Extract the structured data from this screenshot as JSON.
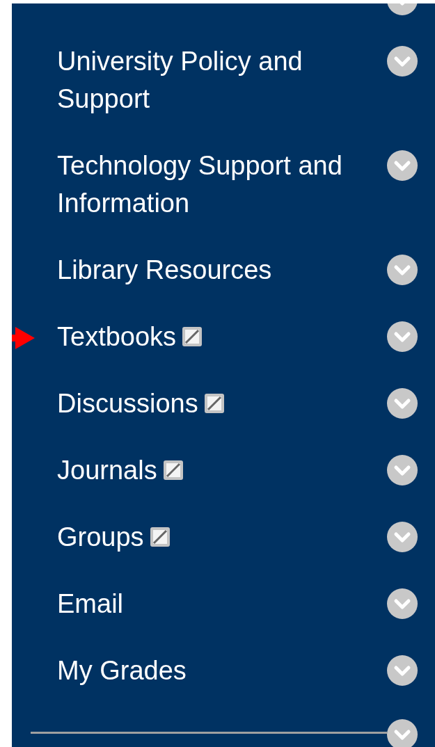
{
  "course_menu": {
    "items": [
      {
        "label": "University Policy and Support",
        "hidden_from_students": false,
        "pointed": false
      },
      {
        "label": "Technology Support and Information",
        "hidden_from_students": false,
        "pointed": false
      },
      {
        "label": "Library Resources",
        "hidden_from_students": false,
        "pointed": false
      },
      {
        "label": "Textbooks",
        "hidden_from_students": true,
        "pointed": true
      },
      {
        "label": "Discussions",
        "hidden_from_students": true,
        "pointed": false
      },
      {
        "label": "Journals",
        "hidden_from_students": true,
        "pointed": false
      },
      {
        "label": "Groups",
        "hidden_from_students": true,
        "pointed": false
      },
      {
        "label": "Email",
        "hidden_from_students": false,
        "pointed": false
      },
      {
        "label": "My Grades",
        "hidden_from_students": false,
        "pointed": false
      }
    ]
  }
}
